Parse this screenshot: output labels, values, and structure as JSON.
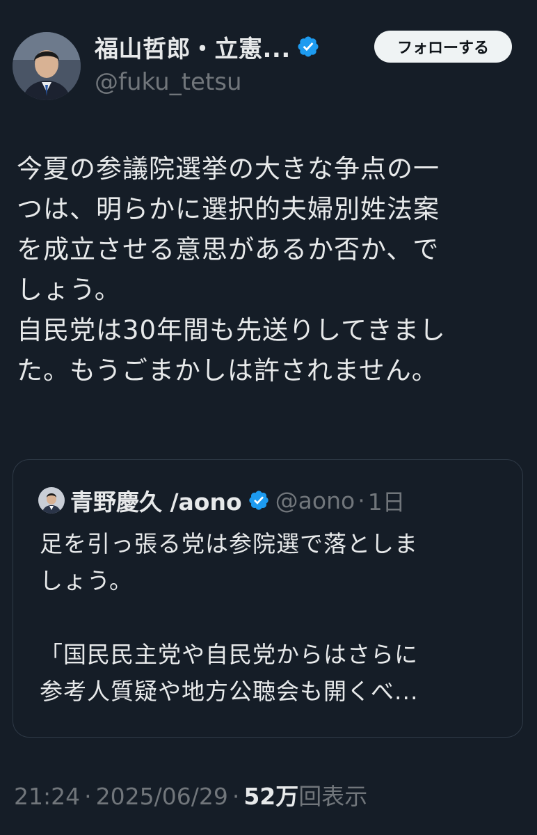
{
  "author": {
    "display_name": "福山哲郎・立憲...",
    "handle": "@fuku_tetsu",
    "verified": true
  },
  "follow_button_label": "フォローする",
  "tweet_text_lines": [
    "今夏の参議院選挙の大きな争点の一",
    "つは、明らかに選択的夫婦別姓法案",
    "を成立させる意思があるか否か、で",
    "しょう。",
    "自民党は30年間も先送りしてきまし",
    "た。もうごまかしは許されません。"
  ],
  "quote": {
    "display_name": "青野慶久 /aono",
    "handle": "@aono",
    "separator": "·",
    "time": "1日",
    "text_lines": [
      "足を引っ張る党は参院選で落としま",
      "しょう。",
      "",
      "「国民民主党や自民党からはさらに",
      "参考人質疑や地方公聴会も開くべ..."
    ]
  },
  "meta": {
    "time": "21:24",
    "separator1": "·",
    "date": "2025/06/29",
    "separator2": "·",
    "views_count": "52万",
    "views_label": "回表示"
  },
  "icons": {
    "verified_badge": "verified-badge-icon"
  },
  "colors": {
    "background": "#151d27",
    "text_primary": "#e7e9ea",
    "text_secondary": "#71767b",
    "verified_blue": "#1d9bf0",
    "follow_bg": "#eff3f4"
  }
}
